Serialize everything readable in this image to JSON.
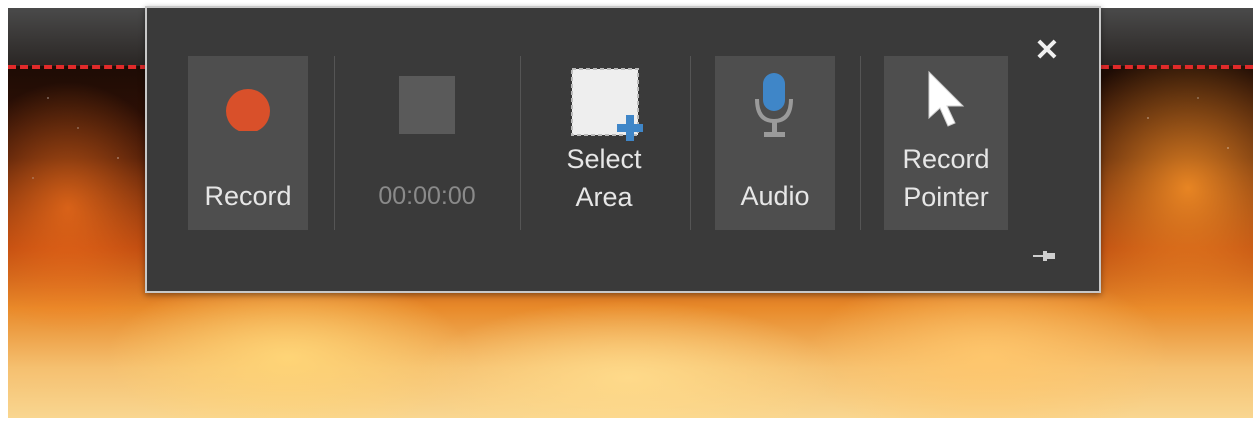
{
  "toolbar": {
    "record_label": "Record",
    "timer": "00:00:00",
    "select_area_label_1": "Select",
    "select_area_label_2": "Area",
    "audio_label": "Audio",
    "record_pointer_label_1": "Record",
    "record_pointer_label_2": "Pointer"
  },
  "colors": {
    "record_dot": "#d9502a",
    "mic_blue": "#3f86c8",
    "plus_blue": "#3f86c8",
    "toolbar_bg": "#3a3a3a",
    "active_button_bg": "#4e4e4e",
    "recording_boundary": "#e02a2a"
  },
  "icons": {
    "record": "record-dot-icon",
    "stop": "stop-square-icon",
    "select_area": "select-area-icon",
    "audio": "microphone-icon",
    "pointer": "mouse-pointer-icon",
    "close": "close-icon",
    "pin": "pin-icon"
  }
}
